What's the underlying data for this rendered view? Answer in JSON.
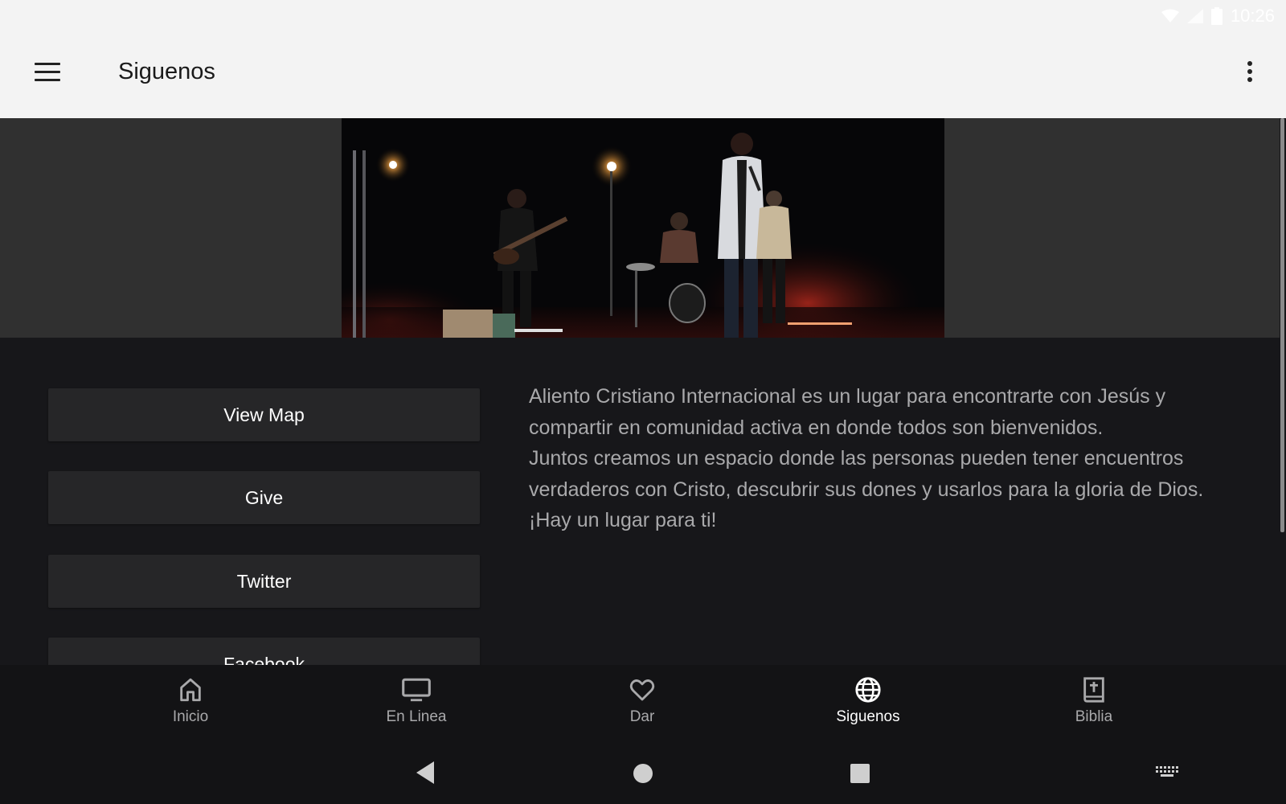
{
  "status_bar": {
    "time": "10:26",
    "icons": [
      "wifi-icon",
      "signal-icon",
      "battery-icon"
    ]
  },
  "app_bar": {
    "title": "Siguenos",
    "menu_icon": "hamburger-menu-icon",
    "overflow_icon": "more-vert-icon"
  },
  "actions": [
    {
      "label": "View Map"
    },
    {
      "label": "Give"
    },
    {
      "label": "Twitter"
    },
    {
      "label": "Facebook"
    }
  ],
  "description": {
    "paragraphs": [
      "Aliento Cristiano Internacional es un lugar para encontrarte con Jesús y compartir en comunidad activa en donde todos son bienvenidos.",
      "Juntos creamos un espacio donde las personas pueden tener encuentros verdaderos con Cristo, descubrir sus dones y usarlos para la gloria de Dios.",
      "¡Hay un lugar para ti!"
    ]
  },
  "bottom_nav": {
    "items": [
      {
        "label": "Inicio",
        "icon": "home-icon"
      },
      {
        "label": "En Linea",
        "icon": "monitor-icon"
      },
      {
        "label": "Dar",
        "icon": "heart-icon"
      },
      {
        "label": "Siguenos",
        "icon": "globe-icon",
        "active": true
      },
      {
        "label": "Biblia",
        "icon": "bible-icon"
      }
    ]
  },
  "colors": {
    "active": "#ffffff",
    "inactive": "#a9a9ab",
    "background": "#17171a",
    "app_bar": "#f3f3f3"
  }
}
